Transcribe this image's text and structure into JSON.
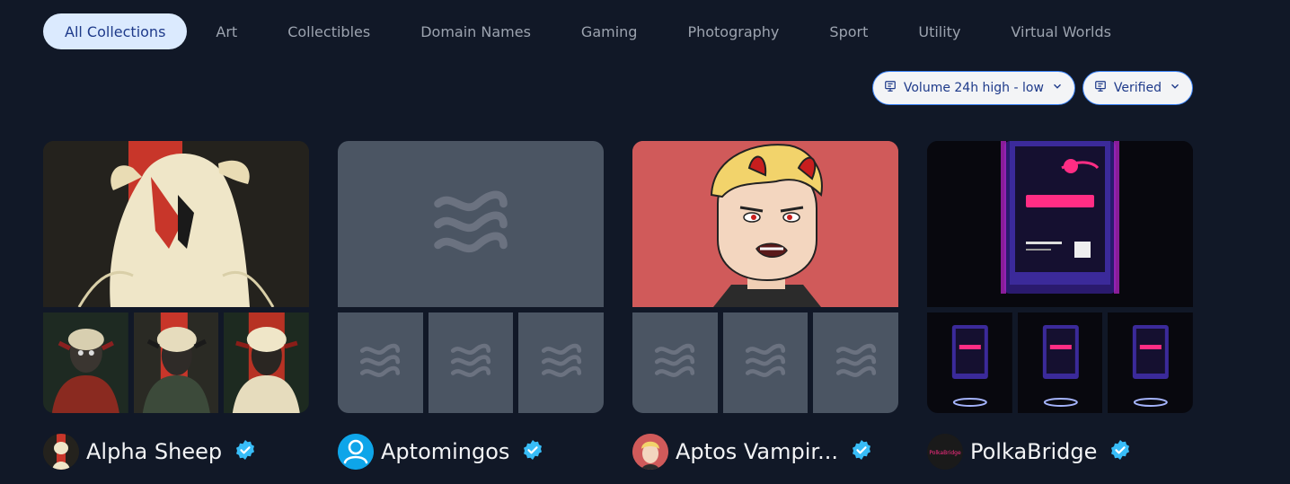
{
  "tabs": [
    {
      "label": "All Collections",
      "active": true
    },
    {
      "label": "Art"
    },
    {
      "label": "Collectibles"
    },
    {
      "label": "Domain Names"
    },
    {
      "label": "Gaming"
    },
    {
      "label": "Photography"
    },
    {
      "label": "Sport"
    },
    {
      "label": "Utility"
    },
    {
      "label": "Virtual Worlds"
    }
  ],
  "filters": {
    "sort_label": "Volume 24h high - low",
    "verified_label": "Verified"
  },
  "collections": [
    {
      "name": "Alpha Sheep",
      "verified": true
    },
    {
      "name": "Aptomingos",
      "verified": true
    },
    {
      "name": "Aptos Vampir...",
      "verified": true
    },
    {
      "name": "PolkaBridge",
      "verified": true,
      "logo_text": "PolkaBridge"
    }
  ],
  "colors": {
    "background": "#111827",
    "tab_active_bg": "#dbeafe",
    "placeholder": "#4b5563",
    "verified": "#38bdf8",
    "vampire_bg": "#d05a5a"
  },
  "icons": {
    "filter": "display-icon",
    "chevron": "chevron-down-icon",
    "placeholder": "waves-icon",
    "verified": "verified-badge-icon",
    "user": "user-icon"
  }
}
